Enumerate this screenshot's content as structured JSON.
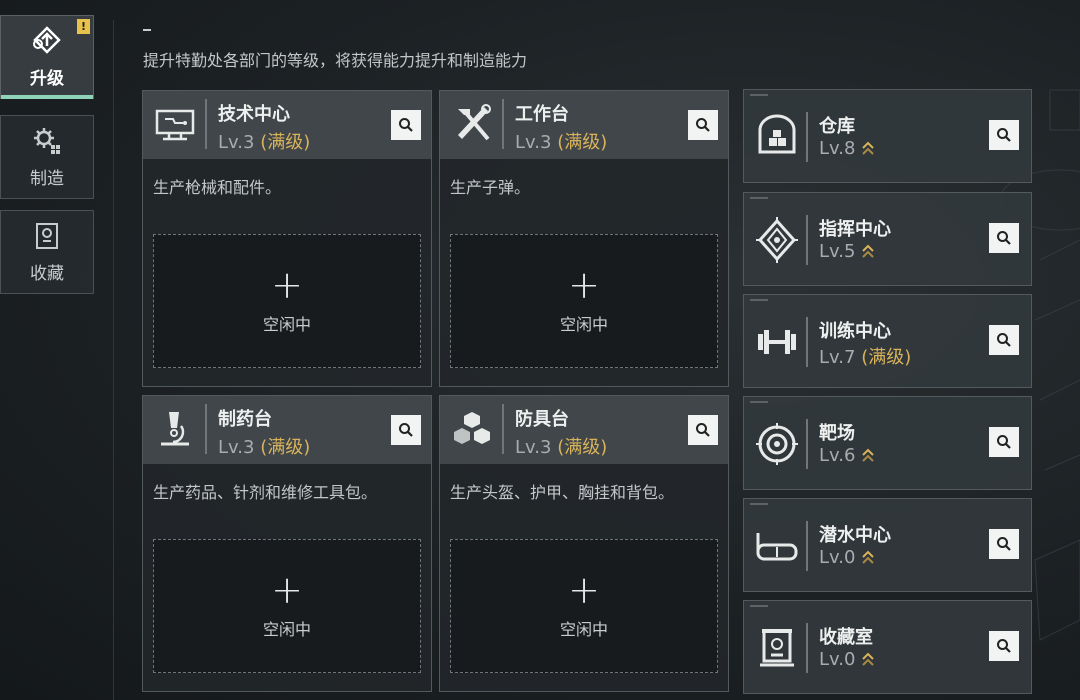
{
  "nav": {
    "items": [
      {
        "label": "升级",
        "icon": "upgrade-icon",
        "active": true
      },
      {
        "label": "制造",
        "icon": "craft-icon",
        "active": false
      },
      {
        "label": "收藏",
        "icon": "collection-icon",
        "active": false
      }
    ],
    "alert": "!"
  },
  "description": "提升特勤处各部门的等级，将获得能力提升和制造能力",
  "cards": [
    {
      "name": "技术中心",
      "level": "Lv.3",
      "max": "(满级)",
      "desc": "生产枪械和配件。",
      "slot": {
        "plus": "+",
        "status": "空闲中"
      },
      "icon": "computer-icon"
    },
    {
      "name": "工作台",
      "level": "Lv.3",
      "max": "(满级)",
      "desc": "生产子弹。",
      "slot": {
        "plus": "+",
        "status": "空闲中"
      },
      "icon": "tools-icon"
    },
    {
      "name": "制药台",
      "level": "Lv.3",
      "max": "(满级)",
      "desc": "生产药品、针剂和维修工具包。",
      "slot": {
        "plus": "+",
        "status": "空闲中"
      },
      "icon": "microscope-icon"
    },
    {
      "name": "防具台",
      "level": "Lv.3",
      "max": "(满级)",
      "desc": "生产头盔、护甲、胸挂和背包。",
      "slot": {
        "plus": "+",
        "status": "空闲中"
      },
      "icon": "boxes-icon"
    }
  ],
  "facilities": [
    {
      "name": "仓库",
      "level": "Lv.8",
      "max": "",
      "icon": "warehouse-icon",
      "upgradable": true
    },
    {
      "name": "指挥中心",
      "level": "Lv.5",
      "max": "",
      "icon": "command-icon",
      "upgradable": true
    },
    {
      "name": "训练中心",
      "level": "Lv.7",
      "max": "(满级)",
      "icon": "dumbbell-icon",
      "upgradable": false
    },
    {
      "name": "靶场",
      "level": "Lv.6",
      "max": "",
      "icon": "target-icon",
      "upgradable": true
    },
    {
      "name": "潜水中心",
      "level": "Lv.0",
      "max": "",
      "icon": "diving-mask-icon",
      "upgradable": true
    },
    {
      "name": "收藏室",
      "level": "Lv.0",
      "max": "",
      "icon": "trophy-icon",
      "upgradable": true
    }
  ],
  "colors": {
    "accent": "#8fd4b8",
    "max_level": "#d9b35a",
    "warning": "#e8c24a",
    "upgrade_chevron": "#d9b35a"
  }
}
